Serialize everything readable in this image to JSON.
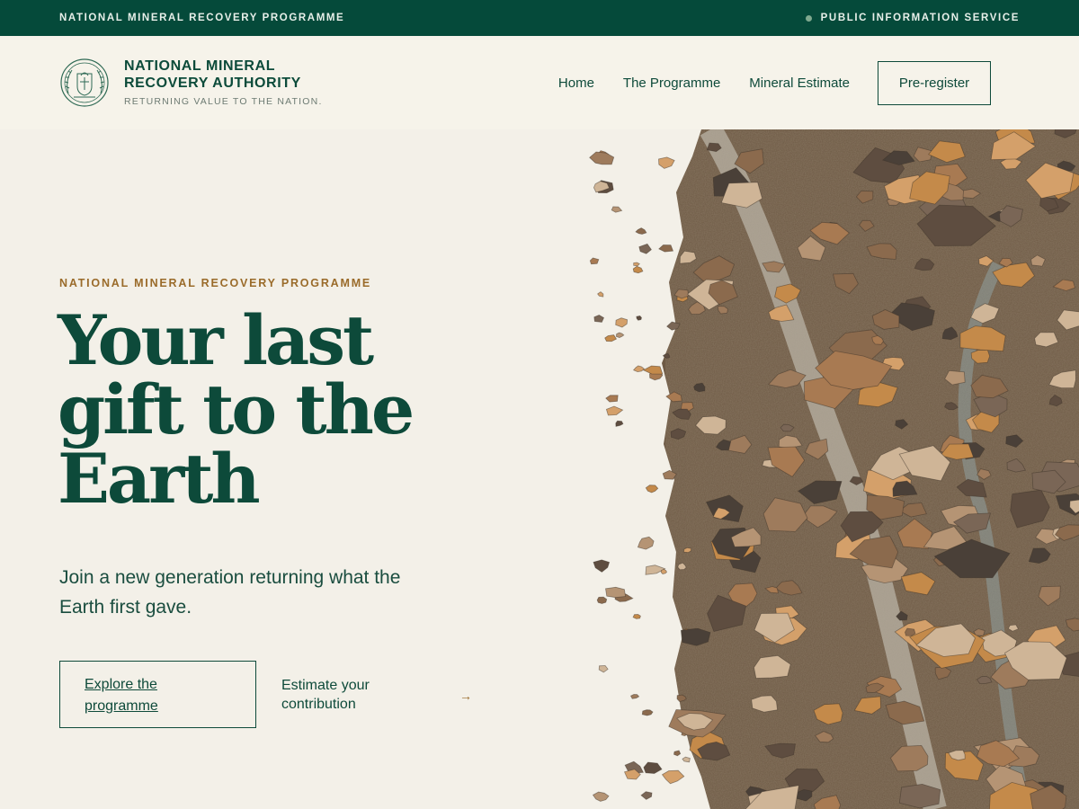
{
  "topbar": {
    "left_text": "NATIONAL MINERAL RECOVERY PROGRAMME",
    "right_text": "PUBLIC INFORMATION SERVICE"
  },
  "header": {
    "brand_line1": "NATIONAL MINERAL",
    "brand_line2": "RECOVERY AUTHORITY",
    "tagline": "RETURNING VALUE TO THE NATION.",
    "nav": {
      "home": "Home",
      "programme": "The Programme",
      "estimate": "Mineral Estimate",
      "preregister": "Pre-register"
    }
  },
  "hero": {
    "eyebrow": "NATIONAL MINERAL RECOVERY PROGRAMME",
    "headline_l1": "Your last",
    "headline_l2": "gift to the",
    "headline_l3": "Earth",
    "subcopy": "Join a new generation returning what the Earth first gave.",
    "cta_primary": "Explore the programme",
    "cta_secondary": "Estimate your contribution",
    "cta_arrow": "→"
  },
  "colors": {
    "brand_green": "#054a3a",
    "accent_gold": "#9a6b2a",
    "background": "#f3f0e8"
  }
}
